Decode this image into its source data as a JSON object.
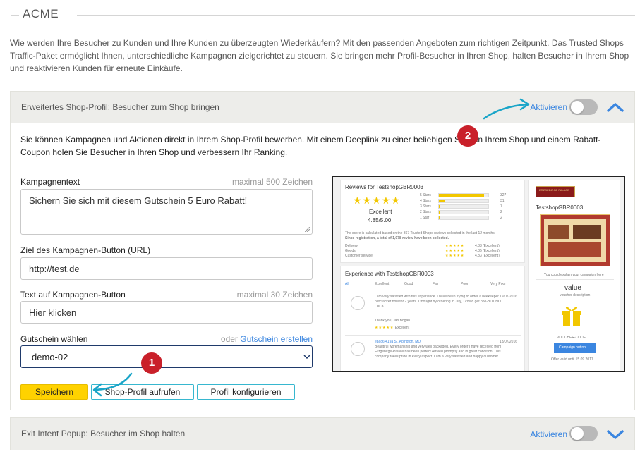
{
  "section_title": "ACME",
  "intro_text": "Wie werden Ihre Besucher zu Kunden und Ihre Kunden zu überzeugten Wiederkäufern? Mit den passenden Angeboten zum richtigen Zeitpunkt. Das Trusted Shops Traffic-Paket ermöglicht Ihnen, unterschiedliche Kampagnen zielgerichtet zu steuern. Sie bringen mehr Profil-Besucher in Ihren Shop, halten Besucher in Ihrem Shop und reaktivieren Kunden für erneute Einkäufe.",
  "panel1": {
    "title": "Erweitertes Shop-Profil: Besucher zum Shop bringen",
    "activate_label": "Aktivieren",
    "toggle_on": false,
    "description": "Sie können Kampagnen und Aktionen direkt in Ihrem Shop-Profil bewerben. Mit einem Deeplink zu einer beliebigen Seite in Ihrem Shop und einem Rabatt-Coupon holen Sie Besucher in Ihren Shop und verbessern Ihr Ranking.",
    "campaign_text": {
      "label": "Kampagnentext",
      "hint": "maximal 500 Zeichen",
      "value": "Sichern Sie sich mit diesem Gutschein 5 Euro Rabatt!"
    },
    "url": {
      "label": "Ziel des Kampagnen-Button (URL)",
      "value": "http://test.de"
    },
    "button_text": {
      "label": "Text auf Kampagnen-Button",
      "hint": "maximal 30 Zeichen",
      "value": "Hier klicken"
    },
    "voucher": {
      "label": "Gutschein wählen",
      "hint_prefix": "oder",
      "hint_link": "Gutschein erstellen",
      "selected": "demo-02"
    },
    "buttons": {
      "save": "Speichern",
      "open_profile": "Shop-Profil aufrufen",
      "configure_profile": "Profil konfigurieren"
    },
    "preview": {
      "reviews_title": "Reviews for TestshopGBR0003",
      "rating_word": "Excellent",
      "rating_score": "4.85/5.00",
      "star_rows": [
        {
          "label": "5 Stars",
          "count": "327",
          "fill": 0.92
        },
        {
          "label": "4 Stars",
          "count": "31",
          "fill": 0.12
        },
        {
          "label": "3 Stars",
          "count": "7",
          "fill": 0.03
        },
        {
          "label": "2 Stars",
          "count": "2",
          "fill": 0.01
        },
        {
          "label": "1 Star",
          "count": "2",
          "fill": 0.01
        }
      ],
      "score_note_1": "The score is calculated based on the 367 Trusted Shops reviews collected in the last 12 months.",
      "score_note_2": "Since registration, a total of 1,078 review have been collected.",
      "criteria": [
        {
          "label": "Delivery",
          "value": "4.83 (Excellent)"
        },
        {
          "label": "Goods",
          "value": "4.85 (Excellent)"
        },
        {
          "label": "Customer service",
          "value": "4.83 (Excellent)"
        }
      ],
      "experience_title": "Experience with TestshopGBR0003",
      "tabs": [
        "All",
        "Excellent",
        "Good",
        "Fair",
        "Poor",
        "Very Poor"
      ],
      "review1_text": "I am very satisfied with this experience. I have been trying to order a beekeeper nutcracker now for 2 years. I thought by ordering in July, I could get one-BUT NO LUCK.",
      "review1_thanks": "Thank you, Jan Bogan",
      "review1_date": "19/07/2016",
      "review1_rating": "Excellent",
      "review2_author": "e8ac6f419a S., Abington, MD",
      "review2_date": "18/07/2016",
      "review2_text": "Beautiful workmanship and very well packaged. Every order I have received from Erzgebirge-Palace has been perfect Arrived promptly and in great condition. This company takes pride in every aspect. I am a very satisfied and happy customer",
      "shop_name": "TestshopGBR0003",
      "logo_text": "ERZGEBIRGE PALACE",
      "campaign_note": "You could explain your campaign here",
      "voucher_value": "value",
      "voucher_desc": "voucher description",
      "voucher_code_label": "VOUCHER-CODE",
      "campaign_button": "Campaign button",
      "offer_valid": "Offer valid until 15.09.2017"
    }
  },
  "panel2": {
    "title": "Exit Intent Popup: Besucher im Shop halten",
    "activate_label": "Aktivieren",
    "toggle_on": false
  },
  "annotations": {
    "badge1": "1",
    "badge2": "2"
  },
  "colors": {
    "accent_blue": "#3b86e0",
    "save_yellow": "#ffd200",
    "annotation_red": "#c9202a",
    "arrow_cyan": "#1aa5c8"
  }
}
